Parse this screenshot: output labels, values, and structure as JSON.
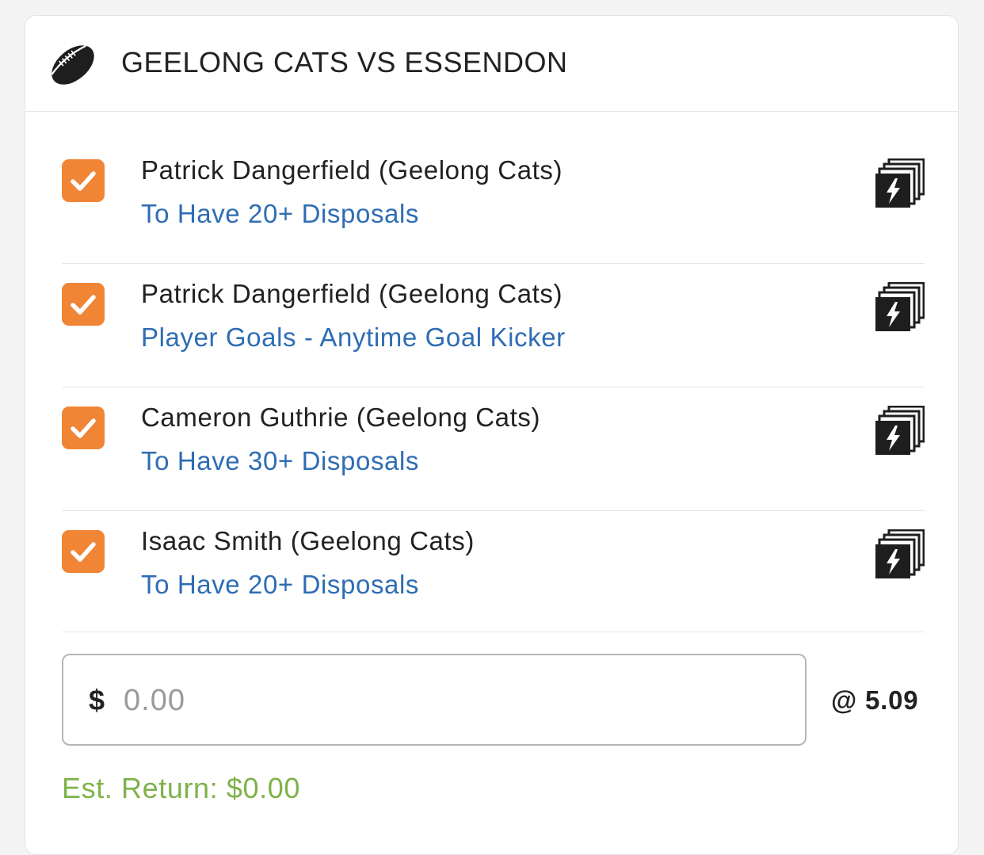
{
  "header": {
    "title": "GEELONG CATS VS ESSENDON",
    "icon": "football-icon"
  },
  "legs": [
    {
      "checked": true,
      "player": "Patrick Dangerfield (Geelong Cats)",
      "market": "To Have 20+ Disposals"
    },
    {
      "checked": true,
      "player": "Patrick Dangerfield (Geelong Cats)",
      "market": "Player Goals - Anytime Goal Kicker"
    },
    {
      "checked": true,
      "player": "Cameron Guthrie (Geelong Cats)",
      "market": "To Have 30+ Disposals"
    },
    {
      "checked": true,
      "player": "Isaac Smith (Geelong Cats)",
      "market": "To Have 20+ Disposals"
    }
  ],
  "stake": {
    "currency": "$",
    "placeholder": "0.00",
    "value": ""
  },
  "odds": "@ 5.09",
  "est_return": "Est. Return: $0.00",
  "colors": {
    "checkbox": "#f08536",
    "market_link": "#2e6db4",
    "est_return": "#7fb24a"
  }
}
